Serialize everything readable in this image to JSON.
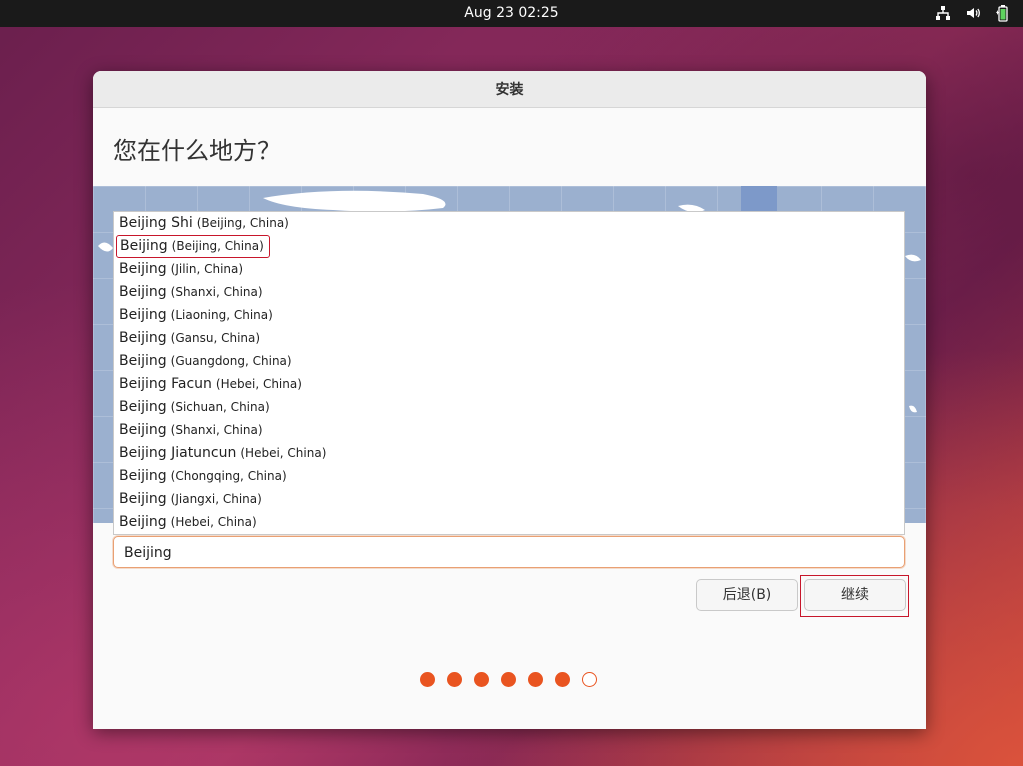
{
  "topbar": {
    "datetime": "Aug 23  02:25",
    "icons": [
      "network-icon",
      "volume-icon",
      "battery-icon"
    ]
  },
  "window": {
    "title": "安装",
    "heading": "您在什么地方？",
    "results": [
      {
        "name": "Beijing Shi",
        "region": "(Beijing, China)"
      },
      {
        "name": "Beijing",
        "region": "(Beijing, China)"
      },
      {
        "name": "Beijing",
        "region": "(Jilin, China)"
      },
      {
        "name": "Beijing",
        "region": "(Shanxi, China)"
      },
      {
        "name": "Beijing",
        "region": "(Liaoning, China)"
      },
      {
        "name": "Beijing",
        "region": "(Gansu, China)"
      },
      {
        "name": "Beijing",
        "region": "(Guangdong, China)"
      },
      {
        "name": "Beijing Facun",
        "region": "(Hebei, China)"
      },
      {
        "name": "Beijing",
        "region": "(Sichuan, China)"
      },
      {
        "name": "Beijing",
        "region": "(Shanxi, China)"
      },
      {
        "name": "Beijing Jiatuncun",
        "region": "(Hebei, China)"
      },
      {
        "name": "Beijing",
        "region": "(Chongqing, China)"
      },
      {
        "name": "Beijing",
        "region": "(Jiangxi, China)"
      },
      {
        "name": "Beijing",
        "region": "(Hebei, China)"
      }
    ],
    "selected_index": 1,
    "search_value": "Beijing",
    "back_label": "后退(B)",
    "continue_label": "继续",
    "progress": {
      "total": 7,
      "completed": 6
    }
  },
  "colors": {
    "accent": "#e95420",
    "selection": "#c7162b"
  }
}
